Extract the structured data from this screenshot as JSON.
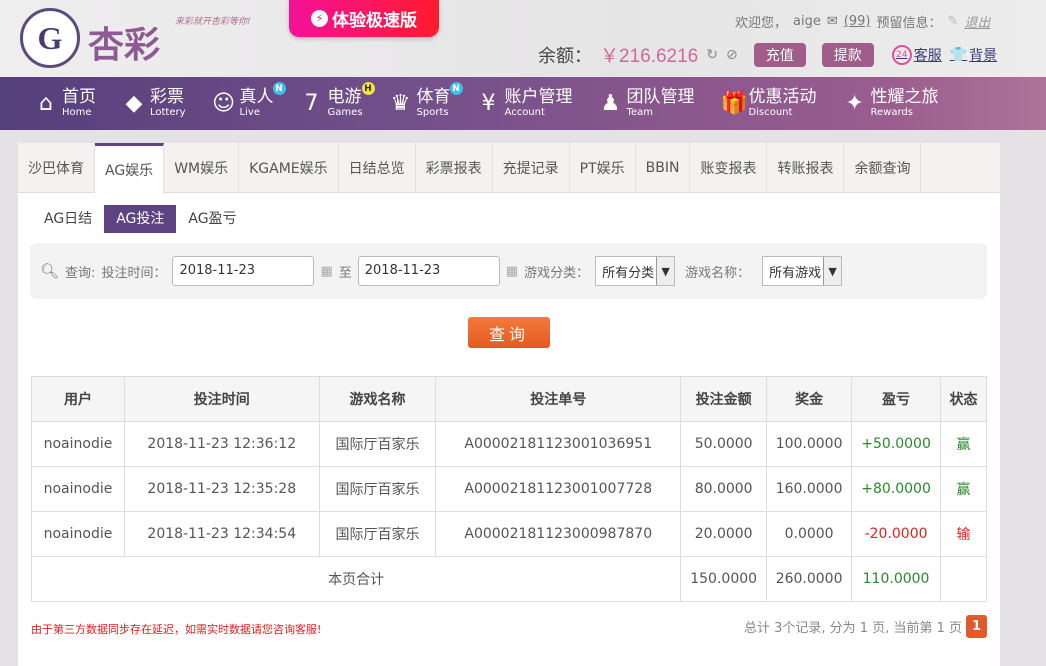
{
  "header": {
    "brand": "杏彩",
    "slogan": "来彩就开杏彩等你!",
    "fast_version": "体验极速版",
    "welcome": "欢迎您，",
    "username": "aige",
    "messages": "(99)",
    "reserve_info": "预留信息：",
    "logout": "退出",
    "balance_label": "余额：",
    "balance": "￥216.6216",
    "deposit": "充值",
    "withdraw": "提款",
    "service": "客服",
    "background": "背景"
  },
  "nav": [
    {
      "zh": "首页",
      "en": "Home",
      "icon": "⌂"
    },
    {
      "zh": "彩票",
      "en": "Lottery",
      "icon": "◆"
    },
    {
      "zh": "真人",
      "en": "Live",
      "icon": "☺",
      "badge": "N"
    },
    {
      "zh": "电游",
      "en": "Games",
      "icon": "7",
      "badge": "H"
    },
    {
      "zh": "体育",
      "en": "Sports",
      "icon": "♛",
      "badge": "N"
    },
    {
      "zh": "账户管理",
      "en": "Account",
      "icon": "¥"
    },
    {
      "zh": "团队管理",
      "en": "Team",
      "icon": "♟"
    },
    {
      "zh": "优惠活动",
      "en": "Discount",
      "icon": "🎁"
    },
    {
      "zh": "性耀之旅",
      "en": "Rewards",
      "icon": "✦"
    }
  ],
  "tabs": [
    "沙巴体育",
    "AG娱乐",
    "WM娱乐",
    "KGAME娱乐",
    "日结总览",
    "彩票报表",
    "充提记录",
    "PT娱乐",
    "BBIN",
    "账变报表",
    "转账报表",
    "余额查询"
  ],
  "subtabs": [
    "AG日结",
    "AG投注",
    "AG盈亏"
  ],
  "filter": {
    "query": "查询:",
    "bet_time": "投注时间：",
    "start": "2018-11-23",
    "to": "至",
    "end": "2018-11-23",
    "category_label": "游戏分类：",
    "category": "所有分类",
    "name_label": "游戏名称：",
    "name": "所有游戏",
    "search": "查询"
  },
  "table": {
    "headers": [
      "用户",
      "投注时间",
      "游戏名称",
      "投注单号",
      "投注金额",
      "奖金",
      "盈亏",
      "状态"
    ],
    "rows": [
      [
        "noainodie",
        "2018-11-23 12:36:12",
        "国际厅百家乐",
        "A00002181123001036951",
        "50.0000",
        "100.0000",
        "+50.0000",
        "赢"
      ],
      [
        "noainodie",
        "2018-11-23 12:35:28",
        "国际厅百家乐",
        "A00002181123001007728",
        "80.0000",
        "160.0000",
        "+80.0000",
        "赢"
      ],
      [
        "noainodie",
        "2018-11-23 12:34:54",
        "国际厅百家乐",
        "A00002181123000987870",
        "20.0000",
        "0.0000",
        "-20.0000",
        "输"
      ]
    ],
    "total_label": "本页合计",
    "total_bet": "150.0000",
    "total_bonus": "260.0000",
    "total_profit": "110.0000"
  },
  "note": "由于第三方数据同步存在延迟，如需实时数据请您咨询客服!",
  "pager": {
    "summary": "总计 3个记录, 分为 1 页, 当前第 1 页",
    "current": "1"
  },
  "colors": {
    "accent": "#5e4383",
    "win": "#2a8a2a",
    "lose": "#dd2222",
    "button": "#e45a1f"
  }
}
